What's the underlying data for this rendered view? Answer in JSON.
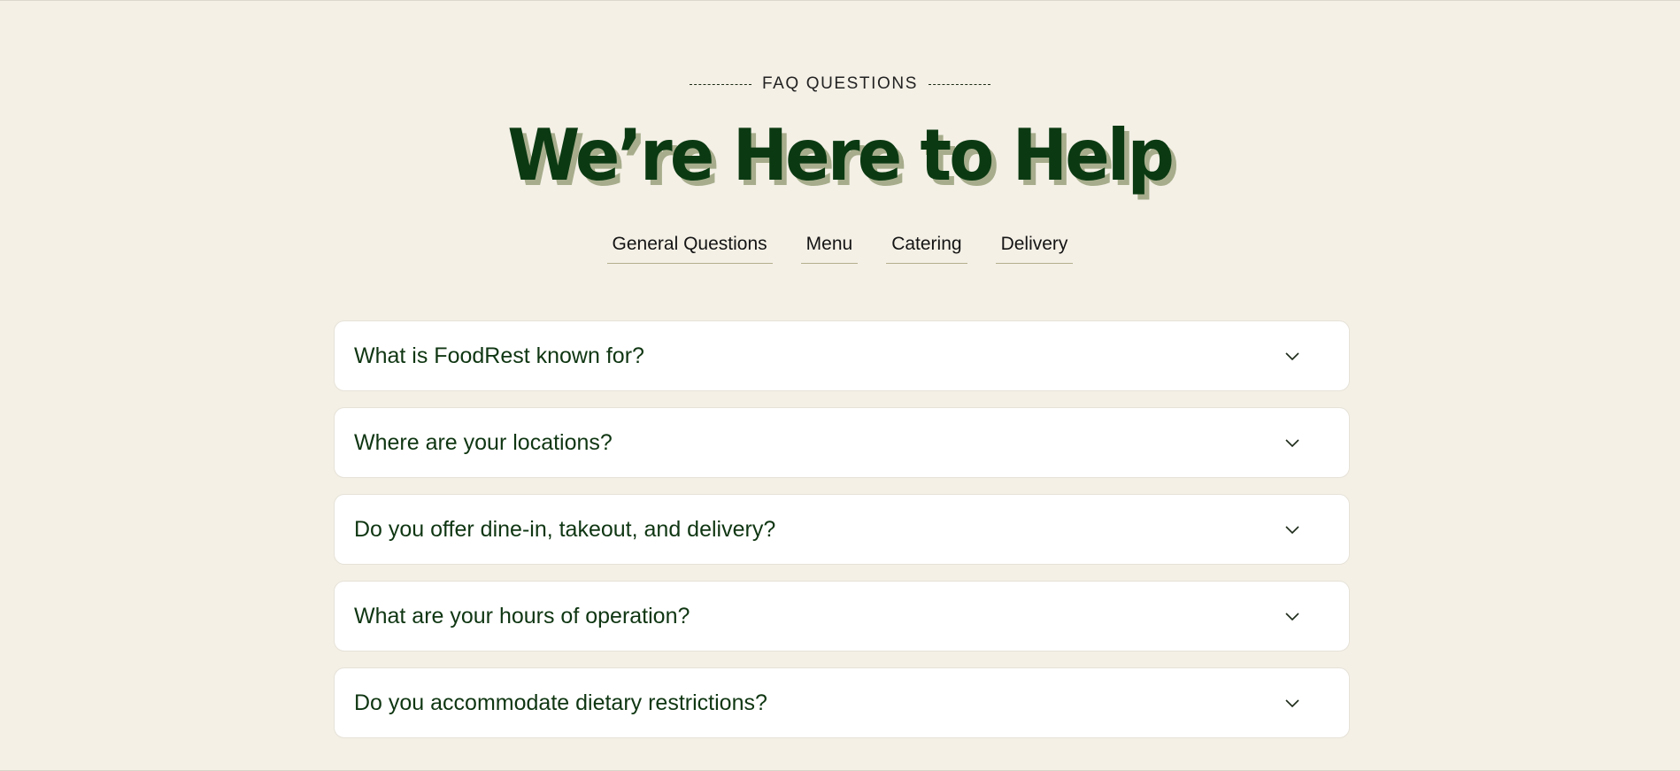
{
  "eyebrow": {
    "label": "FAQ QUESTIONS"
  },
  "headline": "We’re Here to Help",
  "tabs": [
    {
      "label": "General Questions"
    },
    {
      "label": "Menu"
    },
    {
      "label": "Catering"
    },
    {
      "label": "Delivery"
    }
  ],
  "faqs": [
    {
      "question": "What is FoodRest known for?",
      "icon": "chevron-down-icon"
    },
    {
      "question": "Where are your locations?",
      "icon": "chevron-down-icon"
    },
    {
      "question": "Do you offer dine-in, takeout, and delivery?",
      "icon": "chevron-down-icon"
    },
    {
      "question": "What are your hours of operation?",
      "icon": "chevron-down-icon"
    },
    {
      "question": "Do you accommodate dietary restrictions?",
      "icon": "chevron-down-icon"
    }
  ],
  "colors": {
    "background": "#f4f0e6",
    "headline": "#0b3a12",
    "headline_shadow": "#a7ad8c",
    "question_text": "#0f3612",
    "card": "#ffffff"
  }
}
